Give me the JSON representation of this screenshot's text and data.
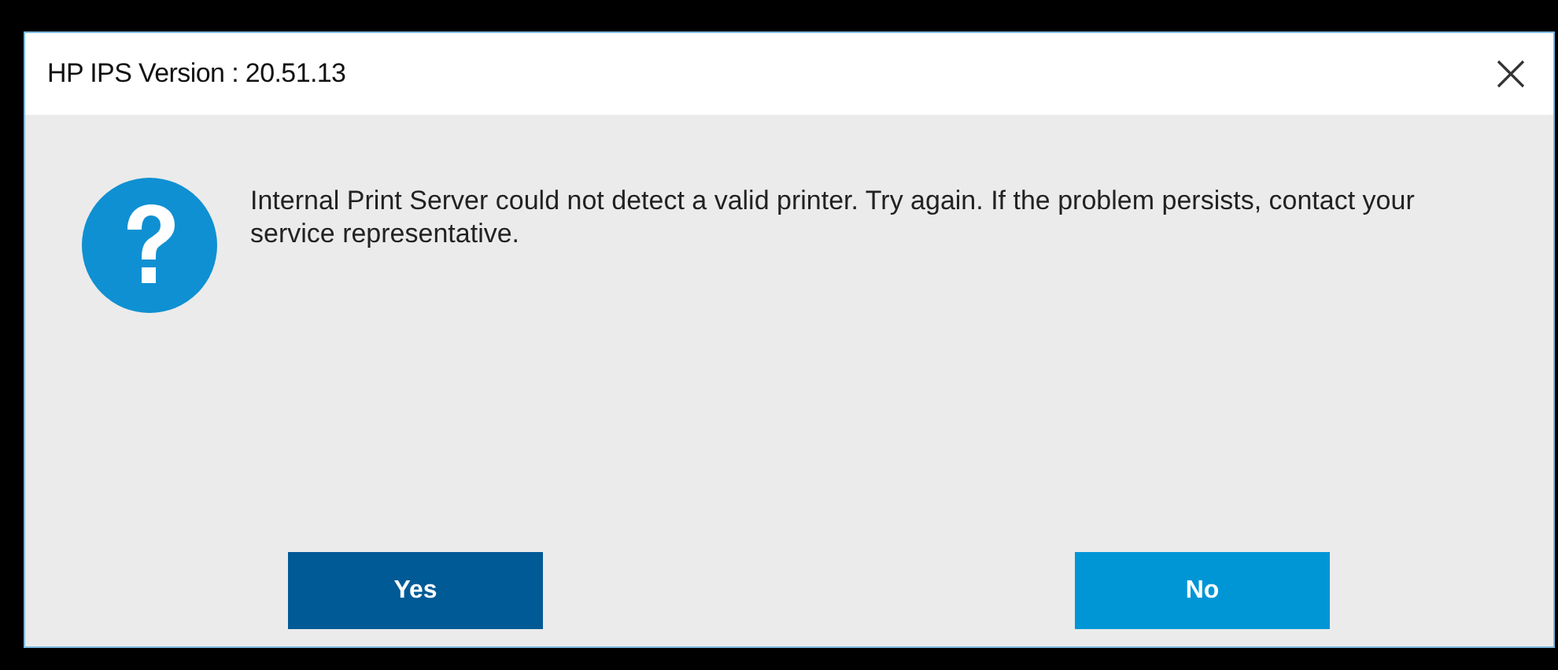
{
  "window": {
    "title": "HP IPS Version : 20.51.13"
  },
  "message": "Internal Print Server could not detect a valid printer. Try again. If the problem persists, contact your service representative.",
  "buttons": [
    {
      "label": "Yes",
      "selected": true
    },
    {
      "label": "No",
      "selected": false
    }
  ]
}
